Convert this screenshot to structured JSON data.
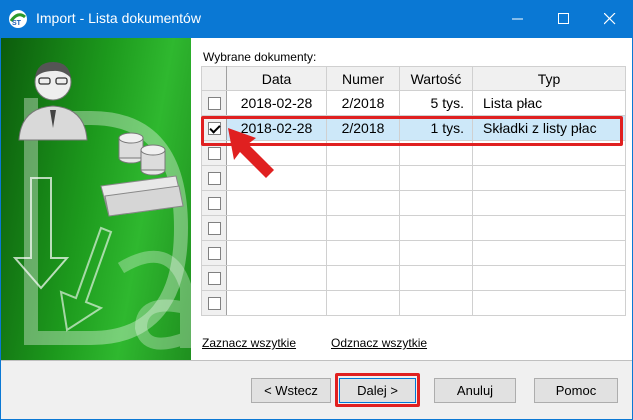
{
  "window": {
    "title": "Import - Lista dokumentów"
  },
  "content": {
    "caption": "Wybrane dokumenty:"
  },
  "table": {
    "columns": [
      "Data",
      "Numer",
      "Wartość",
      "Typ"
    ],
    "rows": [
      {
        "checked": false,
        "data": "2018-02-28",
        "numer": "2/2018",
        "wartosc": "5 tys.",
        "typ": "Lista płac"
      },
      {
        "checked": true,
        "data": "2018-02-28",
        "numer": "2/2018",
        "wartosc": "1 tys.",
        "typ": "Składki z listy płac"
      }
    ]
  },
  "links": {
    "select_all": "Zaznacz wszytkie",
    "deselect_all": "Odznacz wszytkie"
  },
  "buttons": {
    "back": "< Wstecz",
    "next": "Dalej >",
    "cancel": "Anuluj",
    "help": "Pomoc"
  },
  "colors": {
    "titlebar": "#0a78d4",
    "selection": "#cde8f9",
    "annotation": "#e02020",
    "sidebar_green": "#1d9a1d"
  }
}
